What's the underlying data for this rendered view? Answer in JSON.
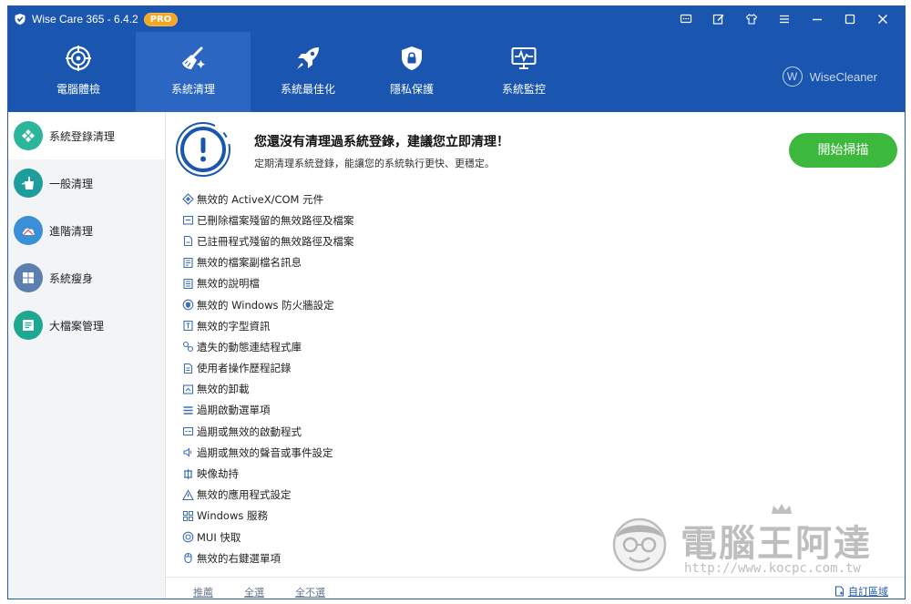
{
  "window": {
    "title": "Wise Care 365 - 6.4.2",
    "badge": "PRO",
    "controls": [
      "feedback-icon",
      "edit-icon",
      "skin-icon",
      "menu-icon",
      "minimize-icon",
      "maximize-icon",
      "close-icon"
    ]
  },
  "nav": {
    "tabs": [
      {
        "label": "電腦體檢",
        "icon": "target-icon"
      },
      {
        "label": "系統清理",
        "icon": "broom-icon",
        "active": true
      },
      {
        "label": "系統最佳化",
        "icon": "rocket-icon"
      },
      {
        "label": "隱私保護",
        "icon": "shield-lock-icon"
      },
      {
        "label": "系統監控",
        "icon": "monitor-icon"
      }
    ],
    "brand": "WiseCleaner",
    "brand_logo": "W"
  },
  "sidebar": {
    "items": [
      {
        "label": "系統登錄清理",
        "icon": "registry-icon",
        "color": "#2bb59a",
        "active": true
      },
      {
        "label": "一般清理",
        "icon": "broom-icon",
        "color": "#1e9e9a"
      },
      {
        "label": "進階清理",
        "icon": "cloud-icon",
        "color": "#3a8fd6"
      },
      {
        "label": "系統瘦身",
        "icon": "windows-icon",
        "color": "#5b7fb0"
      },
      {
        "label": "大檔案管理",
        "icon": "file-icon",
        "color": "#1ea891"
      }
    ]
  },
  "header": {
    "title": "您還沒有清理過系統登錄，建議您立即清理！",
    "subtitle": "定期清理系統登錄，能讓您的系統執行更快、更穩定。",
    "scan_button": "開始掃描"
  },
  "items": [
    {
      "label": "無效的 ActiveX/COM 元件",
      "icon": "activex-icon"
    },
    {
      "label": "已刪除檔案殘留的無效路徑及檔案",
      "icon": "folder-icon"
    },
    {
      "label": "已註冊程式殘留的無效路徑及檔案",
      "icon": "document-icon"
    },
    {
      "label": "無效的檔案副檔名訊息",
      "icon": "file-ext-icon"
    },
    {
      "label": "無效的說明檔",
      "icon": "help-file-icon"
    },
    {
      "label": "無效的 Windows 防火牆設定",
      "icon": "firewall-icon"
    },
    {
      "label": "無效的字型資訊",
      "icon": "font-icon"
    },
    {
      "label": "遺失的動態連結程式庫",
      "icon": "link-icon"
    },
    {
      "label": "使用者操作歷程記錄",
      "icon": "history-icon"
    },
    {
      "label": "無效的卸載",
      "icon": "uninstall-icon"
    },
    {
      "label": "過期啟動選單項",
      "icon": "startmenu-icon"
    },
    {
      "label": "過期或無效的啟動程式",
      "icon": "startup-icon"
    },
    {
      "label": "過期或無效的聲音或事件設定",
      "icon": "sound-icon"
    },
    {
      "label": "映像劫持",
      "icon": "image-hijack-icon"
    },
    {
      "label": "無效的應用程式設定",
      "icon": "app-settings-icon"
    },
    {
      "label": "Windows 服務",
      "icon": "services-icon"
    },
    {
      "label": "MUI 快取",
      "icon": "mui-icon"
    },
    {
      "label": "無效的右鍵選單項",
      "icon": "mouse-icon"
    }
  ],
  "footer": {
    "recommended": "推薦",
    "select_all": "全選",
    "select_none": "全不選",
    "custom_area": "自訂區域"
  },
  "watermark": {
    "text": "電腦王阿達",
    "url": "http://www.kocpc.com.tw"
  },
  "colors": {
    "primary": "#1a56b0",
    "accent_green": "#3cb83c",
    "badge": "#f5a623",
    "item_icon": "#3d6fb8"
  }
}
